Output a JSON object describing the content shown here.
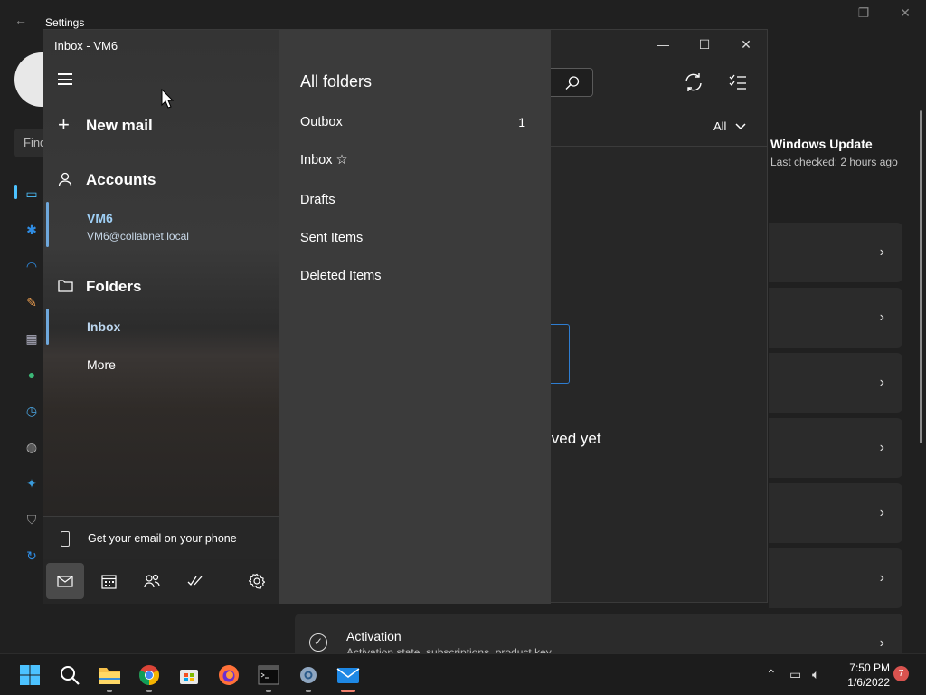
{
  "settings": {
    "title": "Settings",
    "search_placeholder": "Find",
    "windows_update": {
      "title": "Windows Update",
      "subtitle": "Last checked: 2 hours ago"
    },
    "activation": {
      "title": "Activation",
      "subtitle": "Activation state, subscriptions, product key"
    }
  },
  "mail": {
    "window_title": "Inbox - VM6",
    "new_mail_label": "New mail",
    "accounts_label": "Accounts",
    "account": {
      "name": "VM6",
      "email": "VM6@collabnet.local"
    },
    "folders_label": "Folders",
    "folders": [
      {
        "label": "Inbox"
      },
      {
        "label": "More"
      }
    ],
    "phone_promo": "Get your email on your phone",
    "filter_label": "All",
    "empty_message_fragment": "ived yet",
    "all_folders": {
      "title": "All folders",
      "items": [
        {
          "label": "Outbox",
          "count": "1"
        },
        {
          "label": "Inbox ☆",
          "count": ""
        },
        {
          "label": "Drafts",
          "count": ""
        },
        {
          "label": "Sent Items",
          "count": ""
        },
        {
          "label": "Deleted Items",
          "count": ""
        }
      ]
    }
  },
  "taskbar": {
    "apps": [
      "start-icon",
      "search-icon",
      "file-explorer-icon",
      "chrome-icon",
      "store-icon",
      "firefox-icon",
      "terminal-icon",
      "settings-icon",
      "mail-icon"
    ],
    "time": "7:50 PM",
    "date": "1/6/2022",
    "notification_count": "7"
  },
  "colors": {
    "accent": "#4cc2ff",
    "selection": "#6fa8dc",
    "badge": "#d9534f"
  }
}
